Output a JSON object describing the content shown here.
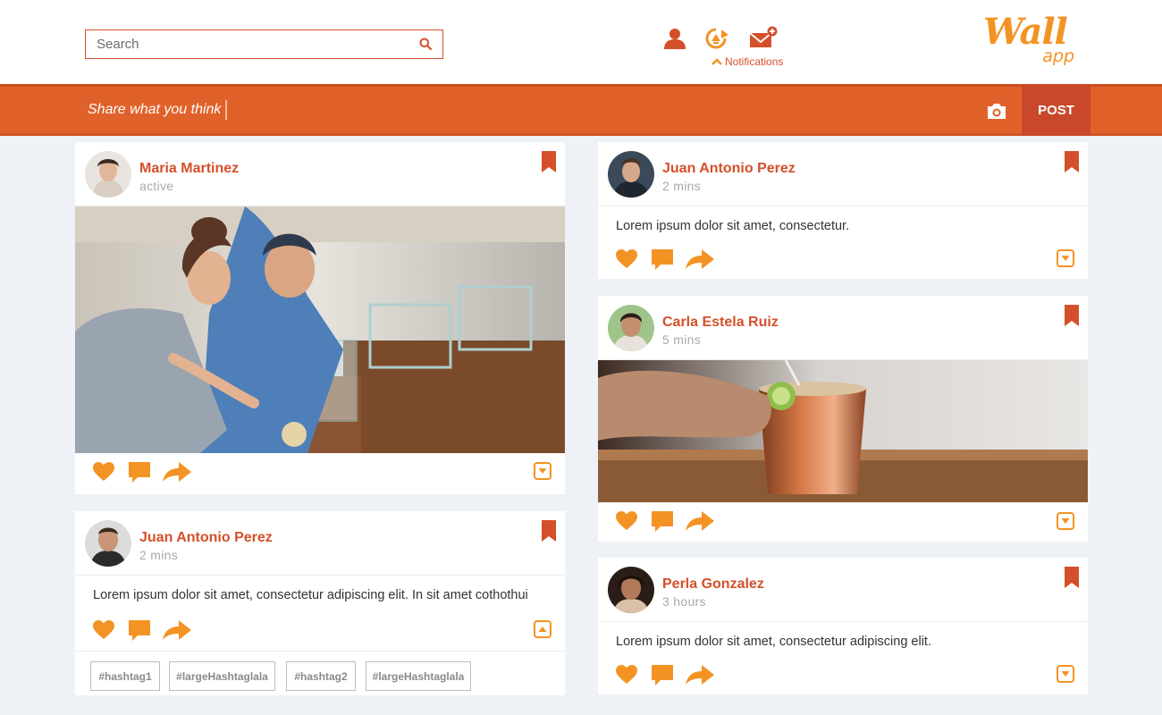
{
  "header": {
    "search_placeholder": "Search",
    "notifications_label": "Notifications",
    "logo_main": "Wall",
    "logo_sub": "app"
  },
  "sharebar": {
    "prompt": "Share what you think",
    "post_label": "POST"
  },
  "colors": {
    "accent": "#d4502a",
    "orange": "#e0622a",
    "icon_orange": "#f39323"
  },
  "posts": [
    {
      "name": "Maria Martinez",
      "time": "active"
    },
    {
      "name": "Juan Antonio Perez",
      "time": "2 mins",
      "text": "Lorem ipsum dolor sit amet, consectetur adipiscing elit. In sit amet cothothui",
      "tags": [
        "#hashtag1",
        "#largeHashtaglala",
        "#hashtag2",
        "#largeHashtaglala"
      ]
    },
    {
      "name": "Juan Antonio Perez",
      "time": "2 mins",
      "text": "Lorem ipsum dolor sit amet, consectetur."
    },
    {
      "name": "Carla Estela Ruiz",
      "time": "5 mins"
    },
    {
      "name": "Perla Gonzalez",
      "time": "3 hours",
      "text": "Lorem ipsum dolor sit amet, consectetur adipiscing elit."
    }
  ]
}
